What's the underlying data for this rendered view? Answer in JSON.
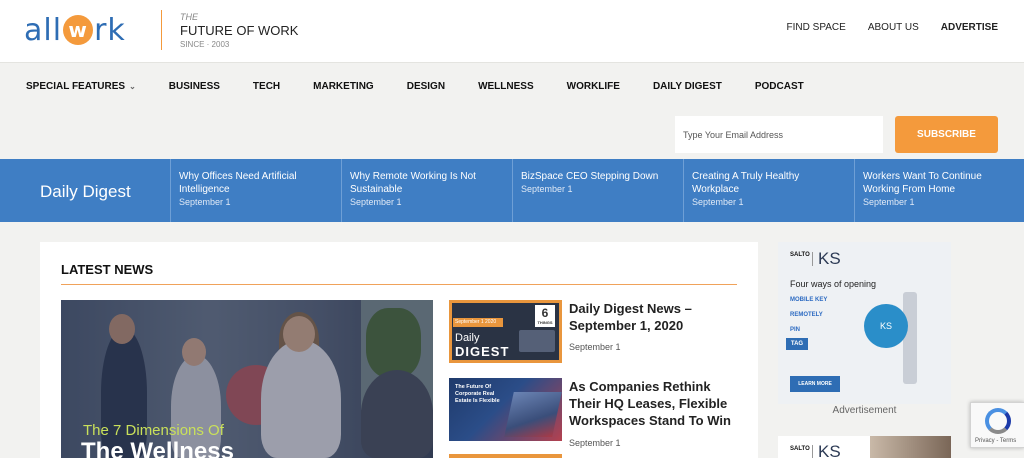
{
  "header": {
    "logo_left": "all",
    "logo_mid": "w",
    "logo_right": "rk",
    "tagline_small": "THE",
    "tagline_main": "FUTURE OF WORK",
    "tagline_since": "SINCE · 2003",
    "nav": [
      {
        "label": "FIND SPACE"
      },
      {
        "label": "ABOUT US"
      },
      {
        "label": "ADVERTISE"
      }
    ]
  },
  "categories": [
    {
      "label": "SPECIAL FEATURES",
      "chevron": "⌄"
    },
    {
      "label": "BUSINESS"
    },
    {
      "label": "TECH"
    },
    {
      "label": "MARKETING"
    },
    {
      "label": "DESIGN"
    },
    {
      "label": "WELLNESS"
    },
    {
      "label": "WORKLIFE"
    },
    {
      "label": "DAILY DIGEST"
    },
    {
      "label": "PODCAST"
    }
  ],
  "subscribe": {
    "placeholder": "Type Your Email Address",
    "button": "SUBSCRIBE"
  },
  "digest": {
    "title": "Daily Digest",
    "items": [
      {
        "title": "Why Offices Need Artificial Intelligence",
        "date": "September 1"
      },
      {
        "title": "Why Remote Working Is Not Sustainable",
        "date": "September 1"
      },
      {
        "title": "BizSpace CEO Stepping Down",
        "date": "September 1"
      },
      {
        "title": "Creating A Truly Healthy Workplace",
        "date": "September 1"
      },
      {
        "title": "Workers Want To Continue Working From Home",
        "date": "September 1"
      }
    ]
  },
  "latest": {
    "heading": "LATEST NEWS",
    "feature": {
      "caption_line1": "The 7 Dimensions Of",
      "caption_line2": "The Wellness"
    },
    "articles": [
      {
        "title": "Daily Digest News – September 1, 2020",
        "date": "September 1",
        "thumb": {
          "band": "September 1 2020",
          "num": "6",
          "num_sub": "THINGS",
          "line1": "Daily",
          "line2": "DIGEST"
        }
      },
      {
        "title": "As Companies Rethink Their HQ Leases, Flexible Workspaces Stand To Win",
        "date": "September 1",
        "thumb": {
          "text": "The Future Of Corporate Real Estate Is Flexible"
        }
      }
    ]
  },
  "ad": {
    "brand": "SALTO",
    "product": "KS",
    "headline": "Four ways of opening",
    "features": [
      "MOBILE KEY",
      "REMOTELY",
      "PIN",
      "TAG"
    ],
    "badge": "KS",
    "cta": "LEARN MORE",
    "label": "Advertisement"
  },
  "recaptcha": {
    "legal": "Privacy - Terms"
  },
  "colors": {
    "brand_blue": "#3f7ec4",
    "accent_orange": "#f49a3c"
  }
}
